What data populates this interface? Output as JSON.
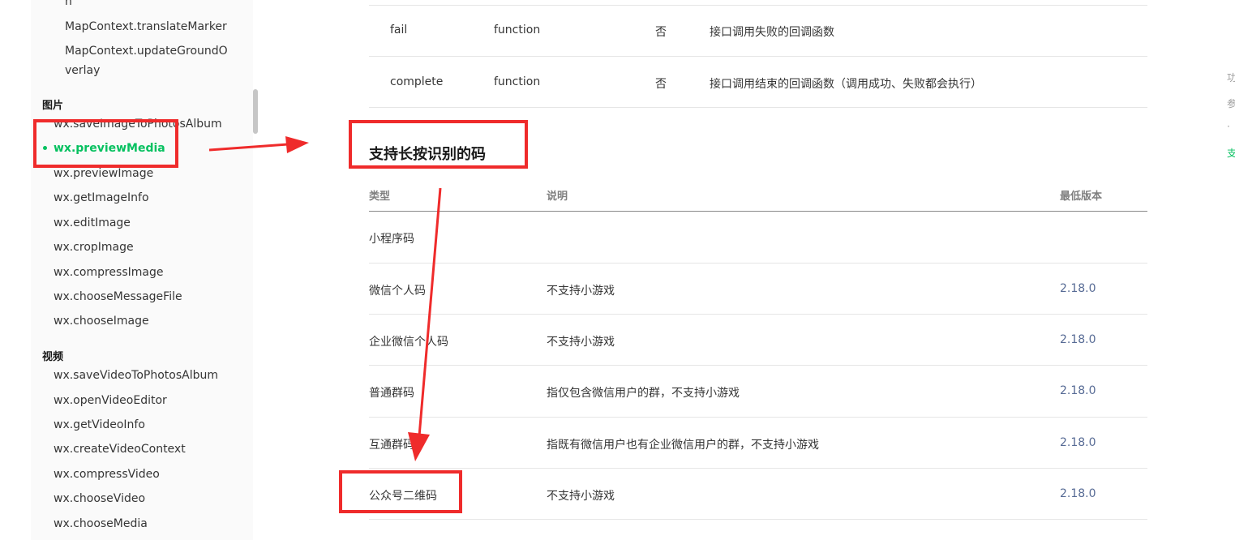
{
  "sidebar": {
    "items_map": [
      "n",
      "MapContext.translateMarker",
      "MapContext.updateGroundO",
      "verlay"
    ],
    "group_image": "图片",
    "items_image": [
      "wx.saveImageToPhotosAlbum",
      "wx.previewMedia",
      "wx.previewImage",
      "wx.getImageInfo",
      "wx.editImage",
      "wx.cropImage",
      "wx.compressImage",
      "wx.chooseMessageFile",
      "wx.chooseImage"
    ],
    "group_video": "视频",
    "items_video": [
      "wx.saveVideoToPhotosAlbum",
      "wx.openVideoEditor",
      "wx.getVideoInfo",
      "wx.createVideoContext",
      "wx.compressVideo",
      "wx.chooseVideo",
      "wx.chooseMedia"
    ]
  },
  "params_table": [
    {
      "name": "fail",
      "type": "function",
      "required": "否",
      "desc": "接口调用失败的回调函数"
    },
    {
      "name": "complete",
      "type": "function",
      "required": "否",
      "desc": "接口调用结束的回调函数（调用成功、失败都会执行）"
    }
  ],
  "section_title": "支持长按识别的码",
  "codes_table": {
    "headers": [
      "类型",
      "说明",
      "最低版本"
    ],
    "rows": [
      {
        "type": "小程序码",
        "desc": "",
        "version": ""
      },
      {
        "type": "微信个人码",
        "desc": "不支持小游戏",
        "version": "2.18.0"
      },
      {
        "type": "企业微信个人码",
        "desc": "不支持小游戏",
        "version": "2.18.0"
      },
      {
        "type": "普通群码",
        "desc": "指仅包含微信用户的群，不支持小游戏",
        "version": "2.18.0"
      },
      {
        "type": "互通群码",
        "desc": "指既有微信用户也有企业微信用户的群，不支持小游戏",
        "version": "2.18.0"
      },
      {
        "type": "公众号二维码",
        "desc": "不支持小游戏",
        "version": "2.18.0"
      }
    ]
  },
  "right_toc": [
    "功",
    "参",
    "·",
    "支"
  ],
  "colors": {
    "active": "#07c160",
    "annotation": "#ef2b2b",
    "version_link": "#576b95"
  }
}
